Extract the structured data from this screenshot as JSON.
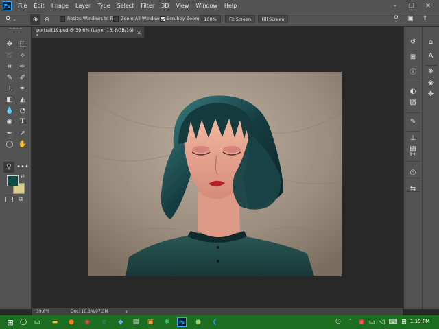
{
  "app": {
    "logo": "Ps"
  },
  "menu": [
    "File",
    "Edit",
    "Image",
    "Layer",
    "Type",
    "Select",
    "Filter",
    "3D",
    "View",
    "Window",
    "Help"
  ],
  "options": {
    "resize_windows": "Resize Windows to Fit",
    "zoom_all": "Zoom All Windows",
    "scrubby_zoom": "Scrubby Zoom",
    "zoom_value": "100%",
    "fit_screen": "Fit Screen",
    "fill_screen": "Fill Screen"
  },
  "document": {
    "tab_title": "portrait19.psd @ 39.6% (Layer 16, RGB/16) *",
    "close": "×"
  },
  "status": {
    "zoom": "39.6%",
    "doc": "Doc: 10.3M/97.3M",
    "arrow": "›"
  },
  "colors": {
    "foreground": "#0e4d44",
    "background": "#d8cf8a",
    "taskbar": "#1e6e22",
    "accent": "#31a8ff"
  },
  "taskbar": {
    "time": "1:19 PM"
  }
}
